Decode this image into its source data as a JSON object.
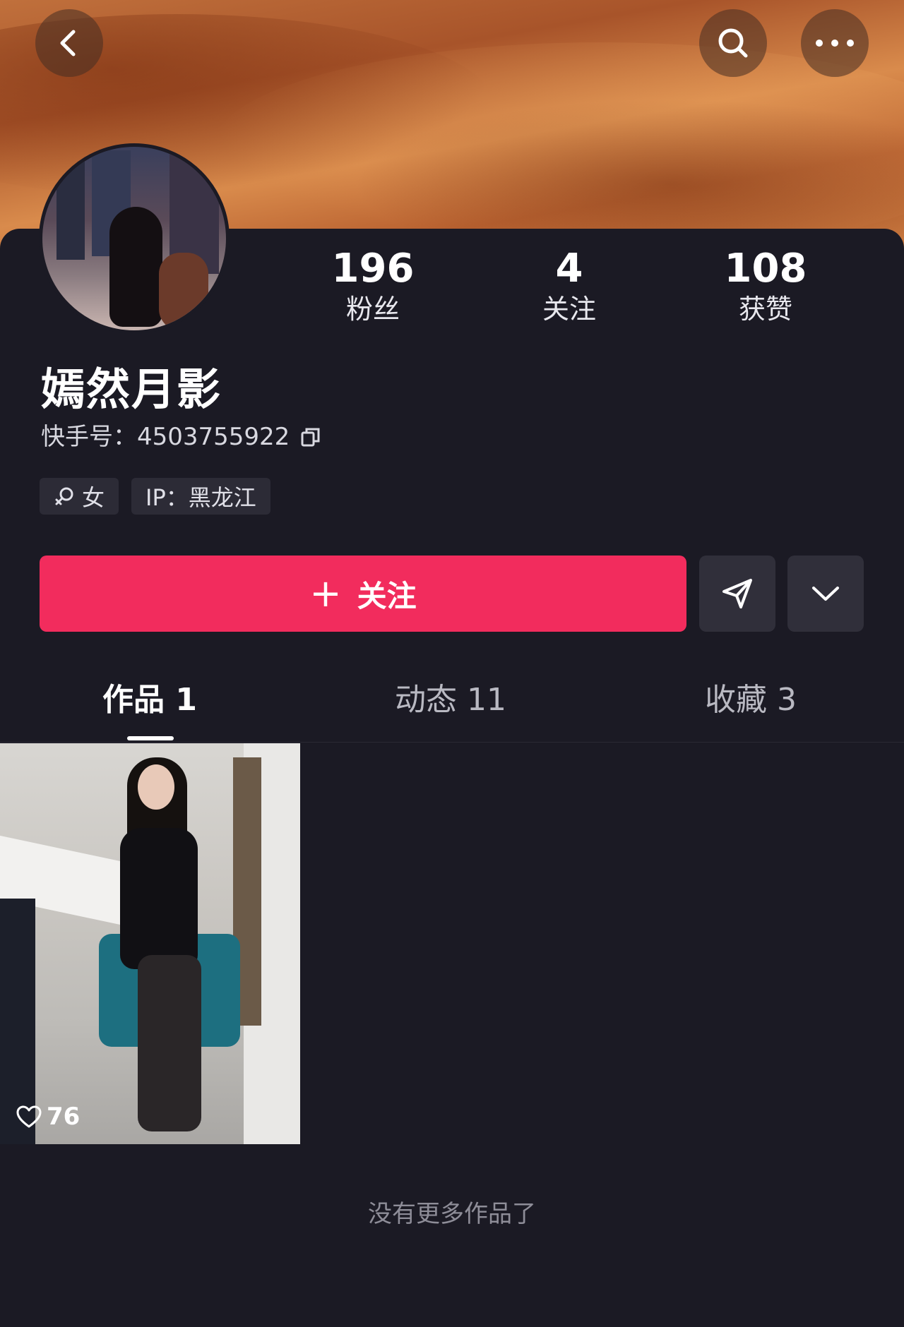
{
  "header": {
    "back_icon": "chevron-left-icon",
    "search_icon": "search-icon",
    "more_icon": "more-dots-icon"
  },
  "profile": {
    "name": "嫣然月影",
    "uid_label": "快手号：4503755922",
    "tags": {
      "gender": "女",
      "ip": "IP：黑龙江"
    }
  },
  "stats": [
    {
      "value": "196",
      "label": "粉丝"
    },
    {
      "value": "4",
      "label": "关注"
    },
    {
      "value": "108",
      "label": "获赞"
    }
  ],
  "actions": {
    "follow_plus": "+",
    "follow_label": "关注"
  },
  "tabs": [
    {
      "label": "作品 1",
      "active": true
    },
    {
      "label": "动态 11",
      "active": false
    },
    {
      "label": "收藏 3",
      "active": false
    }
  ],
  "works": [
    {
      "likes": "76"
    }
  ],
  "footer": {
    "end_text": "没有更多作品了"
  },
  "colors": {
    "follow_button": "#f22c5d",
    "background": "#1b1a24"
  }
}
